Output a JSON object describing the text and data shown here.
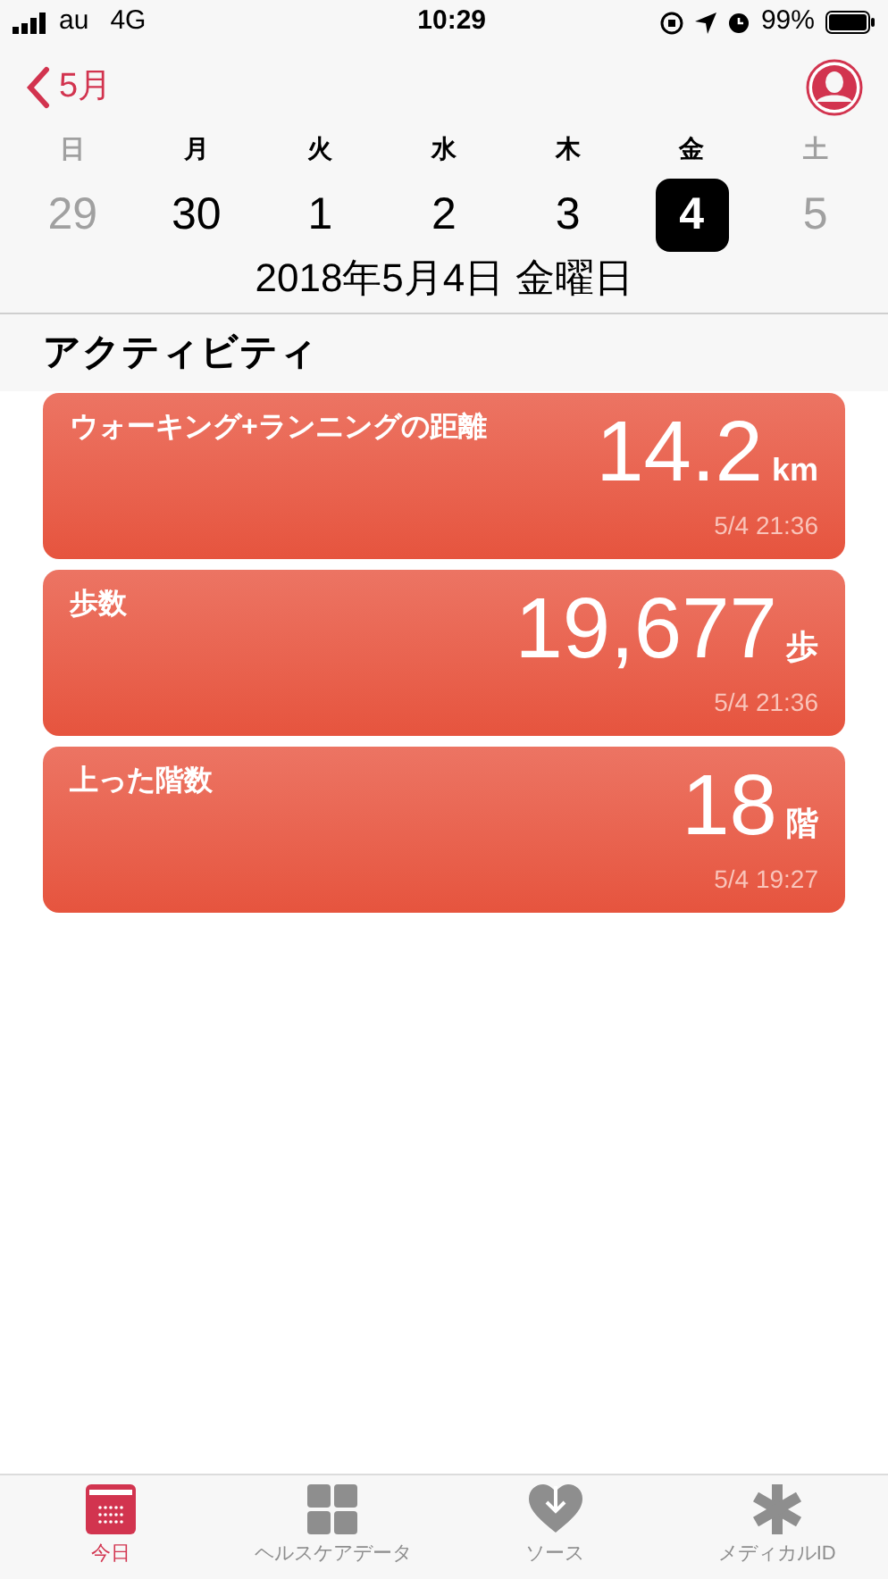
{
  "status_bar": {
    "carrier": "au",
    "network": "4G",
    "time": "10:29",
    "battery": "99%"
  },
  "nav": {
    "back": "5月"
  },
  "week": [
    {
      "weekday": "日",
      "day": "29",
      "weekend": true,
      "selected": false
    },
    {
      "weekday": "月",
      "day": "30",
      "weekend": false,
      "selected": false
    },
    {
      "weekday": "火",
      "day": "1",
      "weekend": false,
      "selected": false
    },
    {
      "weekday": "水",
      "day": "2",
      "weekend": false,
      "selected": false
    },
    {
      "weekday": "木",
      "day": "3",
      "weekend": false,
      "selected": false
    },
    {
      "weekday": "金",
      "day": "4",
      "weekend": false,
      "selected": true
    },
    {
      "weekday": "土",
      "day": "5",
      "weekend": true,
      "selected": false
    }
  ],
  "date_title": "2018年5月4日 金曜日",
  "section": {
    "title": "アクティビティ"
  },
  "cards": [
    {
      "title": "ウォーキング+ランニングの距離",
      "value": "14.2",
      "unit": "km",
      "time": "5/4 21:36"
    },
    {
      "title": "歩数",
      "value": "19,677",
      "unit": "歩",
      "time": "5/4 21:36"
    },
    {
      "title": "上った階数",
      "value": "18",
      "unit": "階",
      "time": "5/4 19:27"
    }
  ],
  "tab_bar": [
    {
      "kind": "calendar",
      "label": "今日",
      "selected": true
    },
    {
      "kind": "grid",
      "label": "ヘルスケアデータ",
      "selected": false
    },
    {
      "kind": "heart",
      "label": "ソース",
      "selected": false
    },
    {
      "kind": "asterisk",
      "label": "メディカルID",
      "selected": false
    }
  ]
}
